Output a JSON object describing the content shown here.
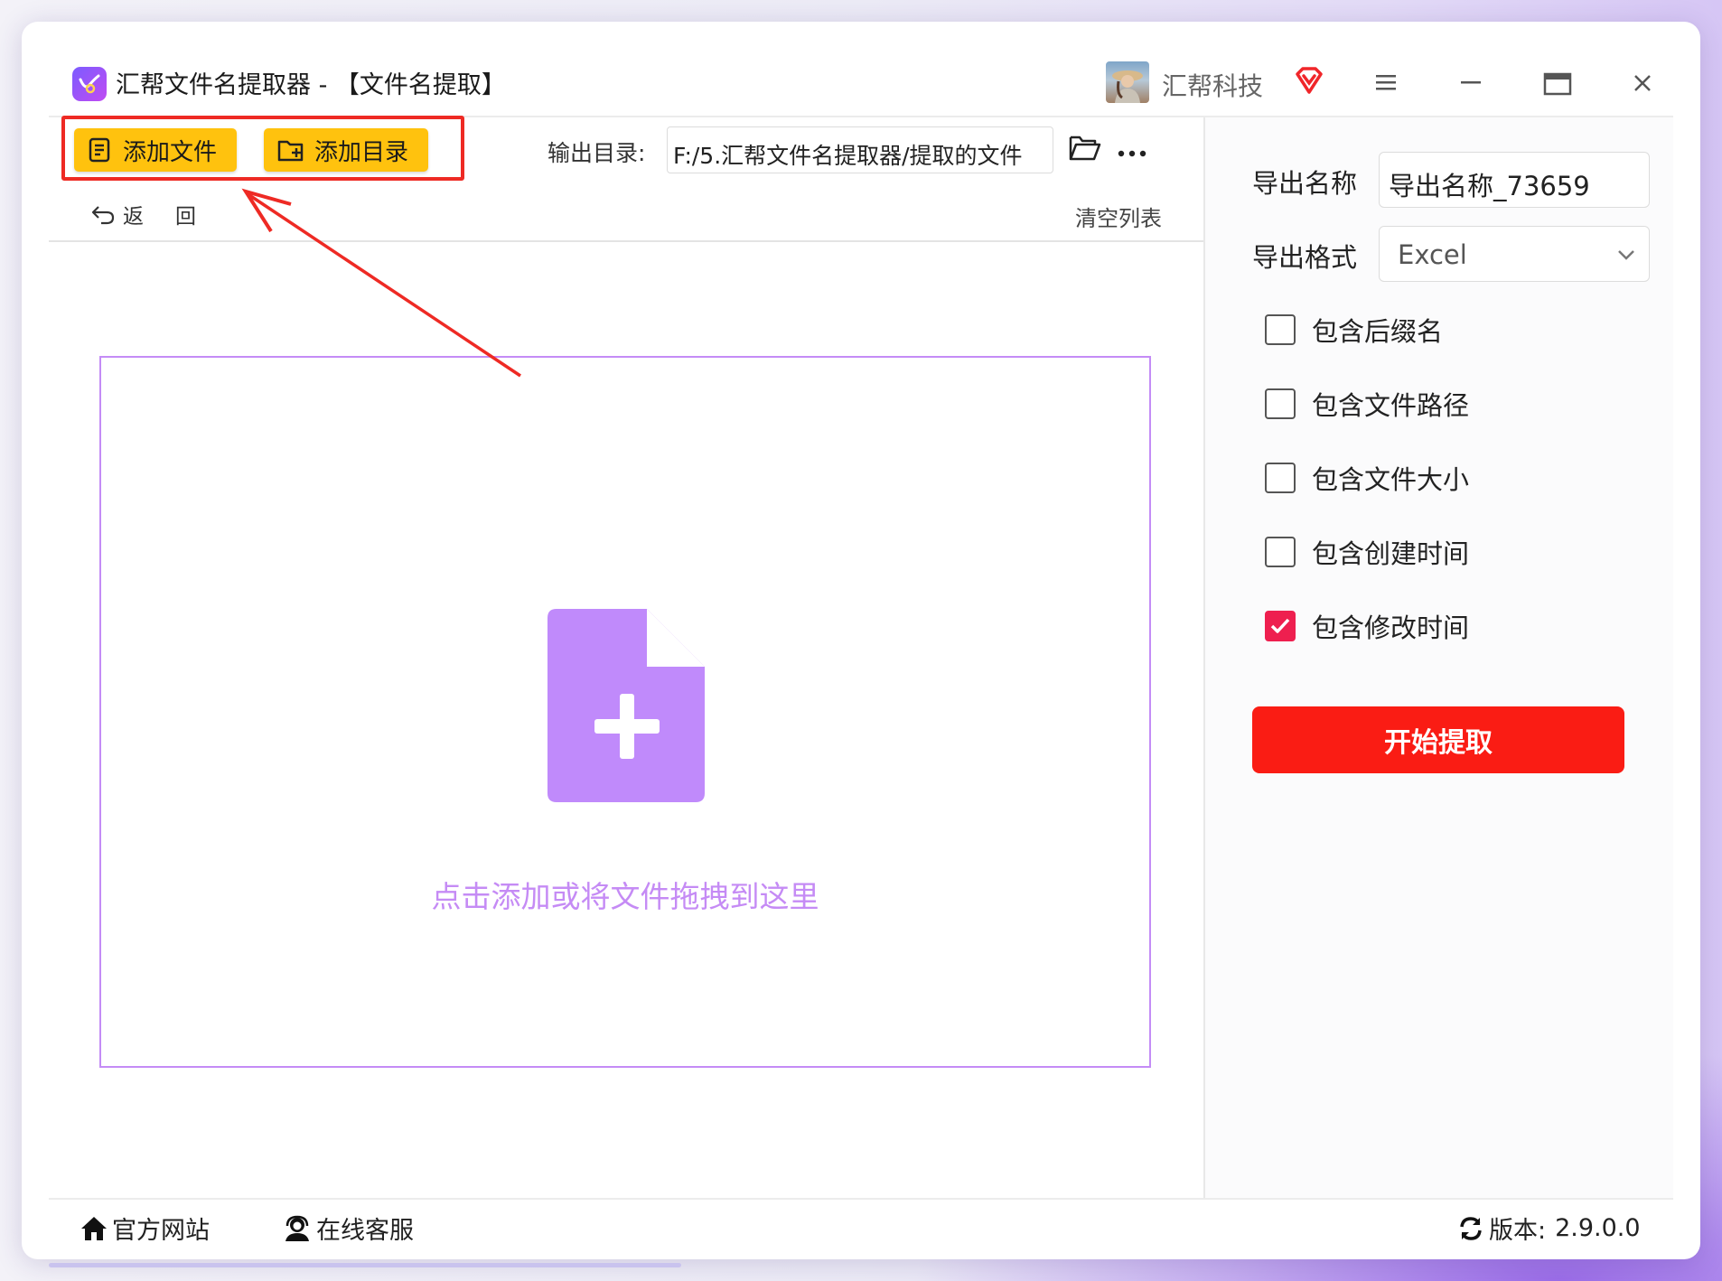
{
  "window": {
    "title": "汇帮文件名提取器 - 【文件名提取】",
    "brand_name": "汇帮科技",
    "icons": [
      "app-logo-icon",
      "vip-diamond-icon",
      "menu-icon",
      "minimize-icon",
      "maximize-icon",
      "close-icon"
    ]
  },
  "toolbar": {
    "add_file_label": "添加文件",
    "add_folder_label": "添加目录",
    "output_dir_label": "输出目录:",
    "output_dir_value": "F:/5.汇帮文件名提取器/提取的文件",
    "back_label": "返　回",
    "clear_label": "清空列表"
  },
  "dropzone": {
    "hint": "点击添加或将文件拖拽到这里"
  },
  "settings": {
    "export_name_label": "导出名称",
    "export_name_value": "导出名称_73659",
    "export_format_label": "导出格式",
    "export_format_value": "Excel",
    "options": [
      {
        "label": "包含后缀名",
        "checked": false
      },
      {
        "label": "包含文件路径",
        "checked": false
      },
      {
        "label": "包含文件大小",
        "checked": false
      },
      {
        "label": "包含创建时间",
        "checked": false
      },
      {
        "label": "包含修改时间",
        "checked": true
      }
    ],
    "start_label": "开始提取"
  },
  "footer": {
    "website_label": "官方网站",
    "support_label": "在线客服",
    "version_label": "版本:",
    "version_value": "2.9.0.0"
  },
  "colors": {
    "accent_yellow": "#ffc20e",
    "accent_red": "#fa1c14",
    "checkbox_checked": "#ee1f4f",
    "dropzone_purple": "#c48cf6",
    "icon_purple": "#c08afb",
    "annotation_red": "#ee2a24"
  }
}
